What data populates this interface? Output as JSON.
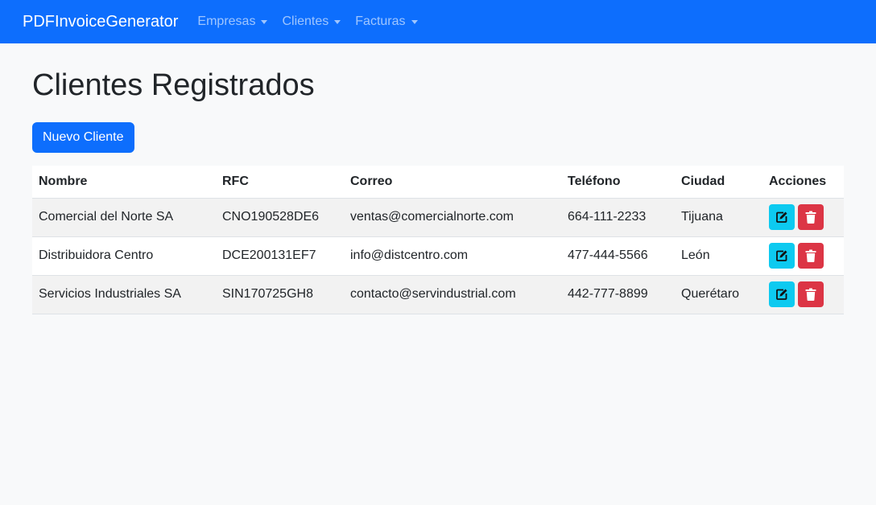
{
  "navbar": {
    "brand": "PDFInvoiceGenerator",
    "items": [
      {
        "label": "Empresas"
      },
      {
        "label": "Clientes"
      },
      {
        "label": "Facturas"
      }
    ]
  },
  "page": {
    "title": "Clientes Registrados",
    "new_button": "Nuevo Cliente"
  },
  "table": {
    "headers": [
      "Nombre",
      "RFC",
      "Correo",
      "Teléfono",
      "Ciudad",
      "Acciones"
    ],
    "rows": [
      {
        "nombre": "Comercial del Norte SA",
        "rfc": "CNO190528DE6",
        "correo": "ventas@comercialnorte.com",
        "telefono": "664-111-2233",
        "ciudad": "Tijuana"
      },
      {
        "nombre": "Distribuidora Centro",
        "rfc": "DCE200131EF7",
        "correo": "info@distcentro.com",
        "telefono": "477-444-5566",
        "ciudad": "León"
      },
      {
        "nombre": "Servicios Industriales SA",
        "rfc": "SIN170725GH8",
        "correo": "contacto@servindustrial.com",
        "telefono": "442-777-8899",
        "ciudad": "Querétaro"
      }
    ],
    "action_icons": {
      "edit": "edit-icon",
      "delete": "trash-icon"
    }
  },
  "colors": {
    "primary": "#0d6efd",
    "info": "#0dcaf0",
    "danger": "#dc3545",
    "background": "#f8f9fa"
  }
}
